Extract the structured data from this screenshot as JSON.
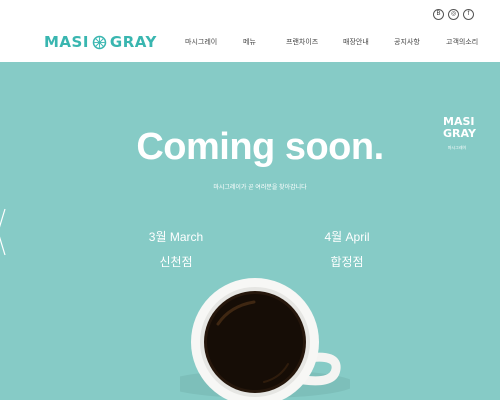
{
  "brand": {
    "logo_left": "MASI",
    "logo_right": "GRAY"
  },
  "social": [
    {
      "icon": "blog-icon",
      "glyph": "B"
    },
    {
      "icon": "instagram-icon",
      "glyph": "◎"
    },
    {
      "icon": "facebook-icon",
      "glyph": "f"
    }
  ],
  "nav": {
    "items": [
      {
        "label": "마시그레이"
      },
      {
        "label": "메뉴"
      },
      {
        "label": "프랜차이즈"
      },
      {
        "label": "매장안내"
      },
      {
        "label": "공지사항"
      },
      {
        "label": "고객의소리"
      }
    ]
  },
  "hero": {
    "title": "Coming soon.",
    "subtitle": "마시그레이가 곧 여러분을 찾아갑니다",
    "stores": [
      {
        "date": "3월 March",
        "name": "신천점"
      },
      {
        "date": "4월 April",
        "name": "합정점"
      }
    ],
    "side_logo": {
      "line1": "MASI",
      "line2": "GRAY",
      "sub": "마시그레이"
    }
  },
  "colors": {
    "accent": "#39b6b0",
    "hero_bg": "#86cbc6"
  }
}
